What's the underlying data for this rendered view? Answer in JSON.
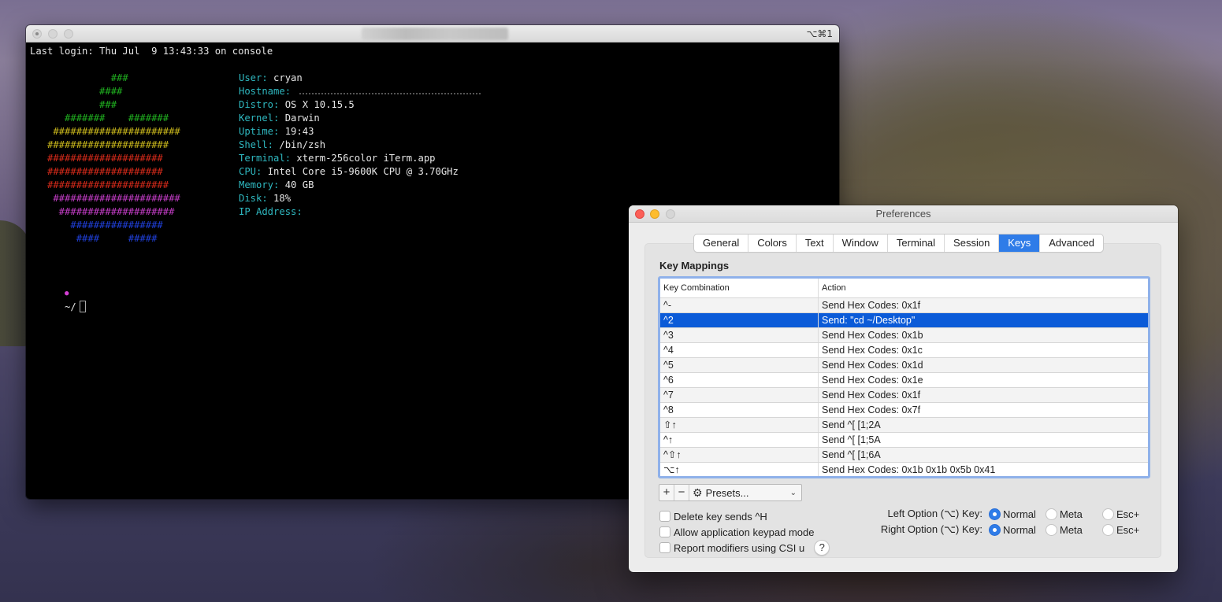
{
  "terminal": {
    "shortcut": "⌥⌘1",
    "last_login": "Last login: Thu Jul  9 13:43:33 on console",
    "art_lines": [
      {
        "text": "              ###",
        "color": "#1fae1f"
      },
      {
        "text": "            ####",
        "color": "#1fae1f"
      },
      {
        "text": "            ###",
        "color": "#1fae1f"
      },
      {
        "text": "      #######    #######",
        "color": "#1fae1f"
      },
      {
        "text": "    ######################",
        "color": "#c8b61c"
      },
      {
        "text": "   #####################",
        "color": "#c8b61c"
      },
      {
        "text": "   ####################",
        "color": "#d42a1a"
      },
      {
        "text": "   ####################",
        "color": "#d42a1a"
      },
      {
        "text": "   #####################",
        "color": "#d42a1a"
      },
      {
        "text": "    ######################",
        "color": "#c13cc4"
      },
      {
        "text": "     ####################",
        "color": "#c13cc4"
      },
      {
        "text": "       ################",
        "color": "#1f3fd8"
      },
      {
        "text": "        ####     #####",
        "color": "#1f3fd8"
      }
    ],
    "info": [
      {
        "label": "User:",
        "value": "cryan"
      },
      {
        "label": "Hostname:",
        "value": ""
      },
      {
        "label": "Distro:",
        "value": "OS X 10.15.5"
      },
      {
        "label": "Kernel:",
        "value": "Darwin"
      },
      {
        "label": "Uptime:",
        "value": "19:43"
      },
      {
        "label": "Shell:",
        "value": "/bin/zsh"
      },
      {
        "label": "Terminal:",
        "value": "xterm-256color iTerm.app"
      },
      {
        "label": "CPU:",
        "value": "Intel Core i5-9600K CPU @ 3.70GHz"
      },
      {
        "label": "Memory:",
        "value": "40 GB"
      },
      {
        "label": "Disk:",
        "value": "18%"
      },
      {
        "label": "IP Address:",
        "value": ""
      }
    ],
    "prompt_symbol": "●",
    "prompt_path": "~/"
  },
  "preferences": {
    "title": "Preferences",
    "tabs": [
      {
        "label": "General",
        "active": false
      },
      {
        "label": "Colors",
        "active": false
      },
      {
        "label": "Text",
        "active": false
      },
      {
        "label": "Window",
        "active": false
      },
      {
        "label": "Terminal",
        "active": false
      },
      {
        "label": "Session",
        "active": false
      },
      {
        "label": "Keys",
        "active": true
      },
      {
        "label": "Advanced",
        "active": false
      }
    ],
    "section_title": "Key Mappings",
    "table": {
      "columns": [
        "Key Combination",
        "Action"
      ],
      "rows": [
        {
          "key": "^-",
          "action": "Send Hex Codes: 0x1f",
          "selected": false
        },
        {
          "key": "^2",
          "action": "Send: \"cd ~/Desktop\"",
          "selected": true
        },
        {
          "key": "^3",
          "action": "Send Hex Codes: 0x1b",
          "selected": false
        },
        {
          "key": "^4",
          "action": "Send Hex Codes: 0x1c",
          "selected": false
        },
        {
          "key": "^5",
          "action": "Send Hex Codes: 0x1d",
          "selected": false
        },
        {
          "key": "^6",
          "action": "Send Hex Codes: 0x1e",
          "selected": false
        },
        {
          "key": "^7",
          "action": "Send Hex Codes: 0x1f",
          "selected": false
        },
        {
          "key": "^8",
          "action": "Send Hex Codes: 0x7f",
          "selected": false
        },
        {
          "key": "⇧↑",
          "action": "Send ^[ [1;2A",
          "selected": false
        },
        {
          "key": "^↑",
          "action": "Send ^[ [1;5A",
          "selected": false
        },
        {
          "key": "^⇧↑",
          "action": "Send ^[ [1;6A",
          "selected": false
        },
        {
          "key": "⌥↑",
          "action": "Send Hex Codes: 0x1b 0x1b 0x5b 0x41",
          "selected": false
        }
      ]
    },
    "tools": {
      "add": "+",
      "remove": "−",
      "presets_label": "Presets...",
      "chevron": "⌄"
    },
    "checkboxes": [
      {
        "label": "Delete key sends ^H",
        "checked": false
      },
      {
        "label": "Allow application keypad mode",
        "checked": false
      },
      {
        "label": "Report modifiers using CSI u",
        "checked": false
      }
    ],
    "help_label": "?",
    "option_keys": [
      {
        "label": "Left Option (⌥) Key:",
        "selected": "Normal",
        "options": [
          "Normal",
          "Meta",
          "Esc+"
        ]
      },
      {
        "label": "Right Option (⌥) Key:",
        "selected": "Normal",
        "options": [
          "Normal",
          "Meta",
          "Esc+"
        ]
      }
    ]
  }
}
